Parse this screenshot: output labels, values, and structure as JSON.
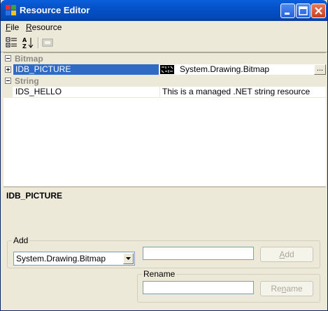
{
  "window": {
    "title": "Resource Editor"
  },
  "menu": {
    "file": "File",
    "resource": "Resource"
  },
  "toolbar": {
    "icons": [
      "categorized-view-icon",
      "alphabetical-sort-icon",
      "property-pages-icon"
    ]
  },
  "grid": {
    "categories": [
      {
        "name": "Bitmap",
        "expander": "minus",
        "items": [
          {
            "name": "IDB_PICTURE",
            "expander": "plus",
            "selected": true,
            "value": "System.Drawing.Bitmap",
            "has_thumbnail": true,
            "ellipsis": "..."
          }
        ]
      },
      {
        "name": "String",
        "expander": "minus",
        "items": [
          {
            "name": "IDS_HELLO",
            "selected": false,
            "value": "This is a managed .NET string resource"
          }
        ]
      }
    ]
  },
  "description": {
    "title": "IDB_PICTURE"
  },
  "add_group": {
    "legend": "Add",
    "type_select": "System.Drawing.Bitmap",
    "name_value": "",
    "button": {
      "pre": "",
      "mnemonic": "A",
      "post": "dd"
    }
  },
  "rename_group": {
    "legend": "Rename",
    "name_value": "",
    "button": {
      "pre": "Re",
      "mnemonic": "n",
      "post": "ame"
    }
  },
  "colors": {
    "titlebar": "#0451c9",
    "selection": "#316ac5",
    "face": "#ece9d8"
  }
}
